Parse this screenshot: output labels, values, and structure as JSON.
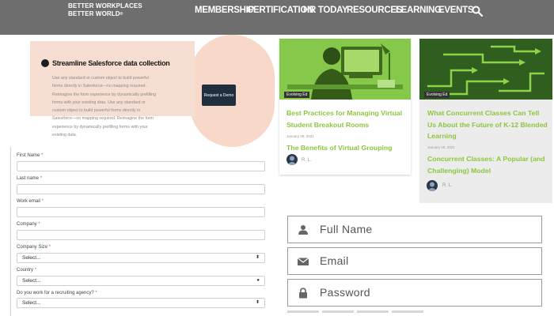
{
  "brand": {
    "line1": "BETTER WORKPLACES",
    "line2": "BETTER WORLD"
  },
  "nav": [
    "MEMBERSHIP",
    "CERTIFICATION",
    "HR TODAY",
    "RESOURCES",
    "LEARNING",
    "EVENTS"
  ],
  "banner": {
    "title": "Streamline Salesforce data collection",
    "body": "Use any standard or custom object to build powerful forms directly in Salesforce—no mapping required. Reimagine the form experience by dynamically prefilling forms with your existing data. Use any standard or custom object to build powerful forms directly in Salesforce—no mapping required. Reimagine the form experience by dynamically prefilling forms with your existing data.",
    "button": "Request a Demo"
  },
  "form": {
    "required_mark": "*",
    "fields": [
      {
        "label": "First Name",
        "type": "text",
        "value": ""
      },
      {
        "label": "Last name",
        "type": "text",
        "value": ""
      },
      {
        "label": "Work email",
        "type": "text",
        "value": ""
      },
      {
        "label": "Company",
        "type": "text",
        "value": ""
      },
      {
        "label": "Company Size",
        "type": "select",
        "value": "Select..."
      },
      {
        "label": "Country",
        "type": "select",
        "value": "Select..."
      },
      {
        "label": "Do you work for a recruiting agency?",
        "type": "select",
        "value": "Select..."
      }
    ]
  },
  "cards": [
    {
      "tag": "Evolving Ed",
      "title": "Best Practices for Managing Virtual Student Breakout Rooms",
      "date": "January 28, 2021",
      "subtitle": "The Benefits of Virtual Grouping",
      "author": "R. L."
    },
    {
      "tag": "Evolving Ed",
      "title": "What Concurrent Classes Can Tell Us About the Future of K-12 Blended Learning",
      "date": "January 26, 2021",
      "subtitle": "Concurrent Classes: A Popular (and Challenging) Model",
      "author": "R. L."
    }
  ],
  "login": {
    "fullname_placeholder": "Full Name",
    "email_placeholder": "Email",
    "password_placeholder": "Password"
  },
  "colors": {
    "nav_bg": "#6e6e6e",
    "accent_green": "#8cc63f",
    "banner_bg": "#f7ded3",
    "demo_button": "#1f2f3d"
  },
  "icons": [
    "search-icon",
    "user-icon",
    "envelope-icon",
    "lock-icon"
  ]
}
